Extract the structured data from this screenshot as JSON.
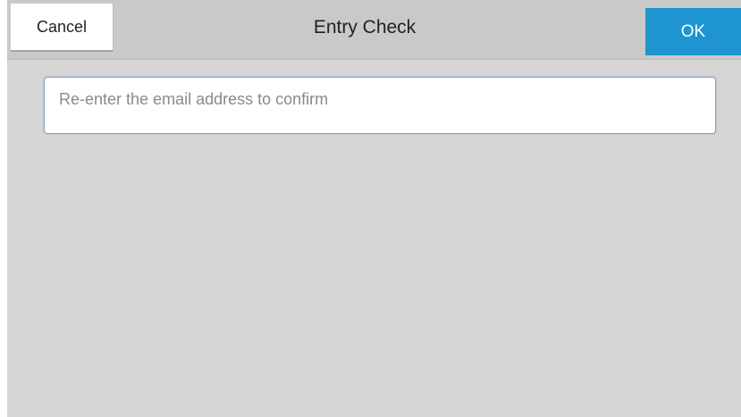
{
  "header": {
    "cancel_label": "Cancel",
    "title": "Entry Check",
    "ok_label": "OK"
  },
  "email_confirm": {
    "value": "",
    "placeholder": "Re-enter the email address to confirm"
  },
  "colors": {
    "header_bg": "#c9c9c9",
    "body_bg": "#d6d6d6",
    "ok_button": "#1e95d0",
    "input_border": "#7fa4c9"
  }
}
